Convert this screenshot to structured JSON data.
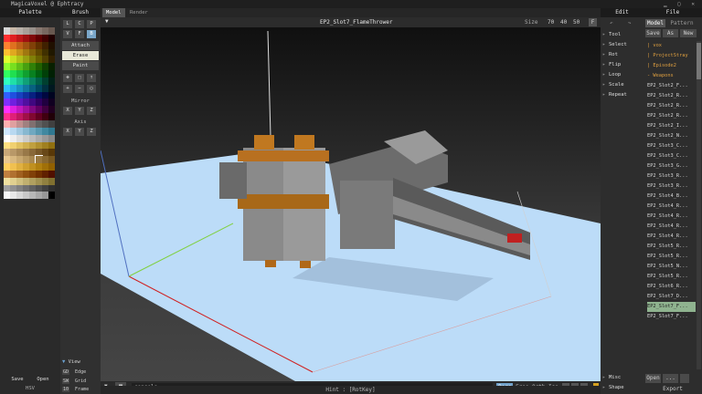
{
  "app": {
    "title": "MagicaVoxel @ Ephtracy"
  },
  "palette": {
    "header": "Palette",
    "save_label": "Save",
    "open_label": "Open",
    "mode_label": "HSV",
    "colors": [
      "#d8d8d8",
      "#c8b8a8",
      "#b8b0a8",
      "#a8a098",
      "#98908a",
      "#887870",
      "#786860",
      "#685850",
      "#ff3030",
      "#e02020",
      "#c01818",
      "#a01010",
      "#800808",
      "#600000",
      "#400000",
      "#200000",
      "#ff8030",
      "#e07020",
      "#c06018",
      "#a05010",
      "#804008",
      "#603000",
      "#402000",
      "#201000",
      "#ffc030",
      "#e0a820",
      "#c09018",
      "#a07810",
      "#806008",
      "#604800",
      "#403000",
      "#201800",
      "#e0ff30",
      "#c8e020",
      "#b0c018",
      "#98a010",
      "#808008",
      "#686000",
      "#504000",
      "#302000",
      "#90ff30",
      "#78e020",
      "#60c018",
      "#48a010",
      "#308008",
      "#206000",
      "#104000",
      "#082000",
      "#30ff60",
      "#20e050",
      "#18c040",
      "#10a030",
      "#088020",
      "#006010",
      "#004008",
      "#002004",
      "#30ffc0",
      "#20e0a8",
      "#18c090",
      "#10a078",
      "#088060",
      "#006048",
      "#004030",
      "#002018",
      "#30c0ff",
      "#20a8e0",
      "#1890c0",
      "#1078a0",
      "#086080",
      "#004860",
      "#003040",
      "#001820",
      "#3060ff",
      "#2050e0",
      "#1840c0",
      "#1030a0",
      "#082080",
      "#001060",
      "#000840",
      "#000420",
      "#8030ff",
      "#7020e0",
      "#6018c0",
      "#5010a0",
      "#400880",
      "#300060",
      "#200040",
      "#100020",
      "#ff30ff",
      "#e020e0",
      "#c018c0",
      "#a010a0",
      "#800880",
      "#600060",
      "#400040",
      "#200020",
      "#ff3090",
      "#e02078",
      "#c01860",
      "#a01048",
      "#800830",
      "#600020",
      "#400010",
      "#200008",
      "#ffb0b0",
      "#e0a0a0",
      "#c09090",
      "#a08080",
      "#807070",
      "#606060",
      "#505050",
      "#404040",
      "#d0e8ff",
      "#b8d8f0",
      "#a0c8e0",
      "#88b8d0",
      "#70a8c0",
      "#5898b0",
      "#4088a0",
      "#307890",
      "#ffffff",
      "#eeeeee",
      "#dddddd",
      "#cccccc",
      "#bbbbbb",
      "#aaaaaa",
      "#999999",
      "#888888",
      "#ffe080",
      "#f0d070",
      "#e0c060",
      "#d0b050",
      "#c0a040",
      "#b09030",
      "#a08020",
      "#907010",
      "#c8a878",
      "#b89868",
      "#a88858",
      "#987848",
      "#886838",
      "#785828",
      "#684818",
      "#583808",
      "#e8c890",
      "#d8b880",
      "#c8a870",
      "#b89860",
      "#a88850",
      "#987840",
      "#886830",
      "#785820",
      "#ffd060",
      "#f0c050",
      "#e0b040",
      "#d0a030",
      "#c09020",
      "#b08010",
      "#a07008",
      "#906000",
      "#c08040",
      "#b07030",
      "#a06020",
      "#905010",
      "#804008",
      "#703000",
      "#602000",
      "#501000",
      "#f0e0a0",
      "#e0d090",
      "#d0c080",
      "#c0b070",
      "#b0a060",
      "#a09050",
      "#908040",
      "#807030",
      "#a0a0a0",
      "#909090",
      "#808080",
      "#707070",
      "#606060",
      "#505050",
      "#404040",
      "#303030",
      "#f8f8f8",
      "#e8e8e8",
      "#d8d8d8",
      "#c8c8c8",
      "#b8b8b8",
      "#a8a8a8",
      "#989898",
      "#000000"
    ]
  },
  "brush": {
    "header": "Brush",
    "shape_buttons": [
      "L",
      "C",
      "P",
      "V",
      "F",
      "B"
    ],
    "modes": [
      "Attach",
      "Erase",
      "Paint"
    ],
    "mirror_label": "Mirror",
    "mirror_axes": [
      "X",
      "Y",
      "Z"
    ],
    "axis_label": "Axis",
    "axis_axes": [
      "X",
      "Y",
      "Z"
    ],
    "view_label": "View",
    "view_options": [
      {
        "key": "GD",
        "label": "Edge"
      },
      {
        "key": "SW",
        "label": "Grid"
      },
      {
        "key": "10",
        "label": "Frame"
      }
    ]
  },
  "viewport": {
    "tabs": [
      "Model",
      "Render"
    ],
    "model_name": "EP2_Slot7_FlameThrower",
    "size_label": "Size",
    "size_values": [
      "70",
      "40",
      "50"
    ],
    "f_button": "F",
    "console_placeholder": "console",
    "camera_modes": [
      "Pers",
      "Free",
      "Orth",
      "Iso"
    ],
    "hint": "Hint : [RotKey]"
  },
  "edit": {
    "header": "Edit",
    "items": [
      "Tool",
      "Select",
      "Rot",
      "Flip",
      "Loop",
      "Scale",
      "Repeat"
    ],
    "misc_label": "Misc",
    "shape_label": "Shape"
  },
  "file": {
    "header": "File",
    "tabs": [
      "Model",
      "Pattern"
    ],
    "actions": [
      "Save",
      "As",
      "New"
    ],
    "dirs": [
      "| vox",
      "| ProjectStray",
      "| Episode2",
      "- Weapons"
    ],
    "files": [
      "EP2_Slot2_F...",
      "EP2_Slot2_R...",
      "EP2_Slot2_R...",
      "EP2_Slot2_R...",
      "EP2_Slot2_I...",
      "EP2_Slot2_N...",
      "EP2_Slot3_C...",
      "EP2_Slot3_C...",
      "EP2_Slot3_G...",
      "EP2_Slot3_R...",
      "EP2_Slot3_R...",
      "EP2_Slot4_B...",
      "EP2_Slot4_R...",
      "EP2_Slot4_R...",
      "EP2_Slot4_R...",
      "EP2_Slot4_R...",
      "EP2_Slot5_R...",
      "EP2_Slot5_R...",
      "EP2_Slot5_N...",
      "EP2_Slot5_R...",
      "EP2_Slot6_R...",
      "EP2_Slot7_D...",
      "EP2_Slot7_F...",
      "EP2_Slot7_F..."
    ],
    "selected_index": 22,
    "open_label": "Open",
    "more_label": "...",
    "export_label": "Export"
  }
}
